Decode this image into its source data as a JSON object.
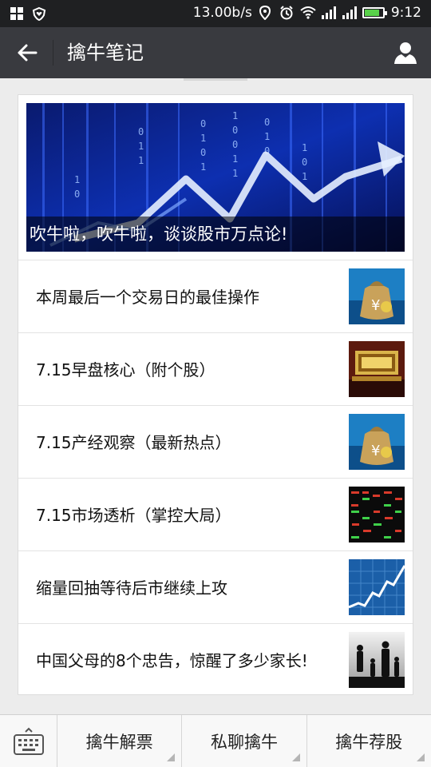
{
  "status_bar": {
    "speed": "13.00b/s",
    "time": "9:12",
    "battery_level": 0.75,
    "icons": [
      "grid-app-icon",
      "heart-shield-icon",
      "location-icon",
      "alarm-icon",
      "wifi-icon",
      "signal-icon",
      "signal-icon",
      "battery-icon"
    ]
  },
  "header": {
    "title": "擒牛笔记",
    "back_icon": "arrow-left-icon",
    "profile_icon": "person-icon"
  },
  "hero": {
    "caption": "吹牛啦，吹牛啦，谈谈股市万点论!"
  },
  "articles": [
    {
      "title": "本周最后一个交易日的最佳操作",
      "thumb": "money-bag-thumbnail"
    },
    {
      "title": "7.15早盘核心（附个股）",
      "thumb": "gold-text-thumbnail"
    },
    {
      "title": "7.15产经观察（最新热点）",
      "thumb": "money-bag-thumbnail"
    },
    {
      "title": "7.15市场透析（掌控大局）",
      "thumb": "stock-board-thumbnail"
    },
    {
      "title": "缩量回抽等待后市继续上攻",
      "thumb": "blue-chart-thumbnail"
    },
    {
      "title": "中国父母的8个忠告，惊醒了多少家长!",
      "thumb": "family-silhouette-thumbnail"
    }
  ],
  "bottom_menu": {
    "keyboard_icon": "keyboard-icon",
    "items": [
      "擒牛解票",
      "私聊擒牛",
      "擒牛荐股"
    ]
  },
  "colors": {
    "status_bar": "#1f2022",
    "header": "#393a3f",
    "battery": "#59d14a",
    "background": "#ececec"
  }
}
